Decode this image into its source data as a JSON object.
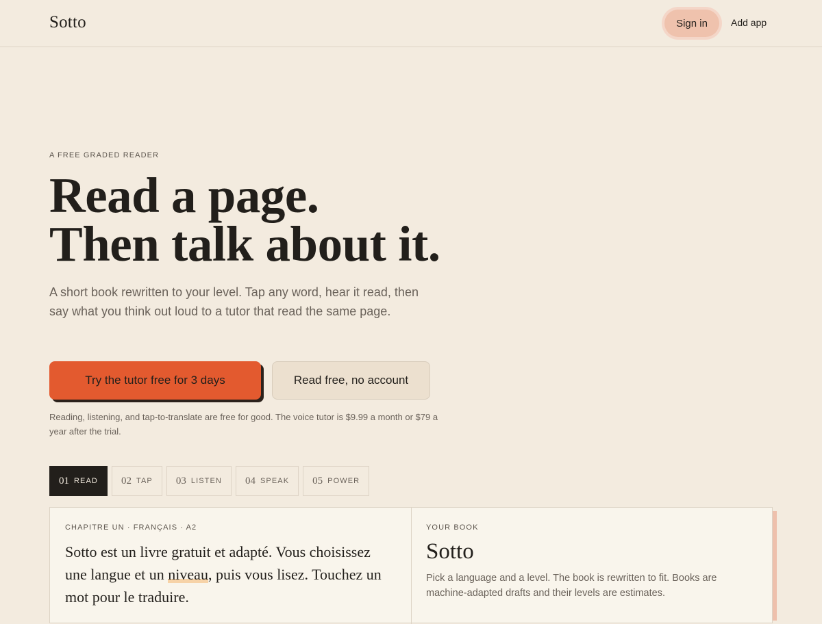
{
  "header": {
    "logo": "Sotto",
    "signin_label": "Sign in",
    "addapp_label": "Add app"
  },
  "hero": {
    "eyebrow": "A FREE GRADED READER",
    "headline_line1": "Read a page.",
    "headline_line2": "Then talk about it.",
    "lede": "A short book rewritten to your level. Tap any word, hear it read, then say what you think out loud to a tutor that read the same page.",
    "primary_cta": "Try the tutor free for 3 days",
    "secondary_cta": "Read free, no account",
    "fineprint": "Reading, listening, and tap-to-translate are free for good. The voice tutor is $9.99 a month or $79 a year after the trial."
  },
  "tabs": [
    {
      "num": "01",
      "label": "READ",
      "active": true
    },
    {
      "num": "02",
      "label": "TAP",
      "active": false
    },
    {
      "num": "03",
      "label": "LISTEN",
      "active": false
    },
    {
      "num": "04",
      "label": "SPEAK",
      "active": false
    },
    {
      "num": "05",
      "label": "POWER",
      "active": false
    }
  ],
  "reader": {
    "chapter_meta": "CHAPITRE UN · FRANÇAIS · A2",
    "passage_before": "Sotto est un livre gratuit et adapté. Vous choisissez une langue et un ",
    "passage_highlight": "niveau",
    "passage_after": ", puis vous lisez. Touchez un mot pour le traduire."
  },
  "book": {
    "eyebrow": "YOUR BOOK",
    "title": "Sotto",
    "description": "Pick a language and a level. The book is rewritten to fit. Books are machine-adapted drafts and their levels are estimates."
  },
  "colors": {
    "background": "#f3ebdf",
    "accent": "#e35a2f",
    "signin_bg": "#efc2ad",
    "ink": "#221f1b",
    "highlight": "#f7d3a8"
  }
}
